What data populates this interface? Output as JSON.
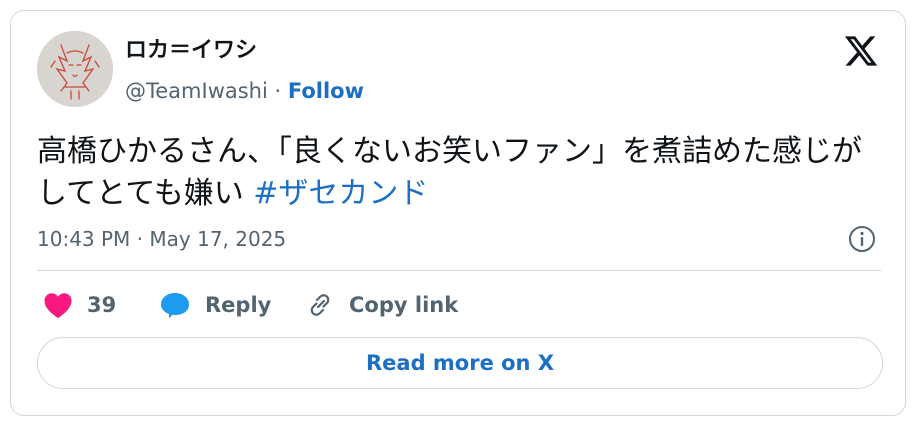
{
  "author": {
    "display_name": "ロカ＝イワシ",
    "handle": "@TeamIwashi",
    "separator": " · ",
    "follow_label": "Follow",
    "avatar_icon": "sketch-avatar-icon"
  },
  "tweet": {
    "text": "高橋ひかるさん、「良くないお笑いファン」を煮詰めた感じがしてとても嫌い ",
    "hashtag": "#ザセカンド",
    "timestamp": "10:43 PM · May 17, 2025"
  },
  "actions": {
    "like_count": "39",
    "reply_label": "Reply",
    "copy_label": "Copy link"
  },
  "read_more_label": "Read more on X",
  "colors": {
    "like": "#f91880",
    "reply": "#1d9bf0",
    "link": "#1d6fc4",
    "text": "#0f1419",
    "secondary": "#536471",
    "border": "#cfd9de"
  },
  "icons": {
    "brand": "x-logo-icon",
    "info": "info-icon",
    "like": "heart-icon",
    "reply": "speech-bubble-icon",
    "copy": "link-icon"
  }
}
